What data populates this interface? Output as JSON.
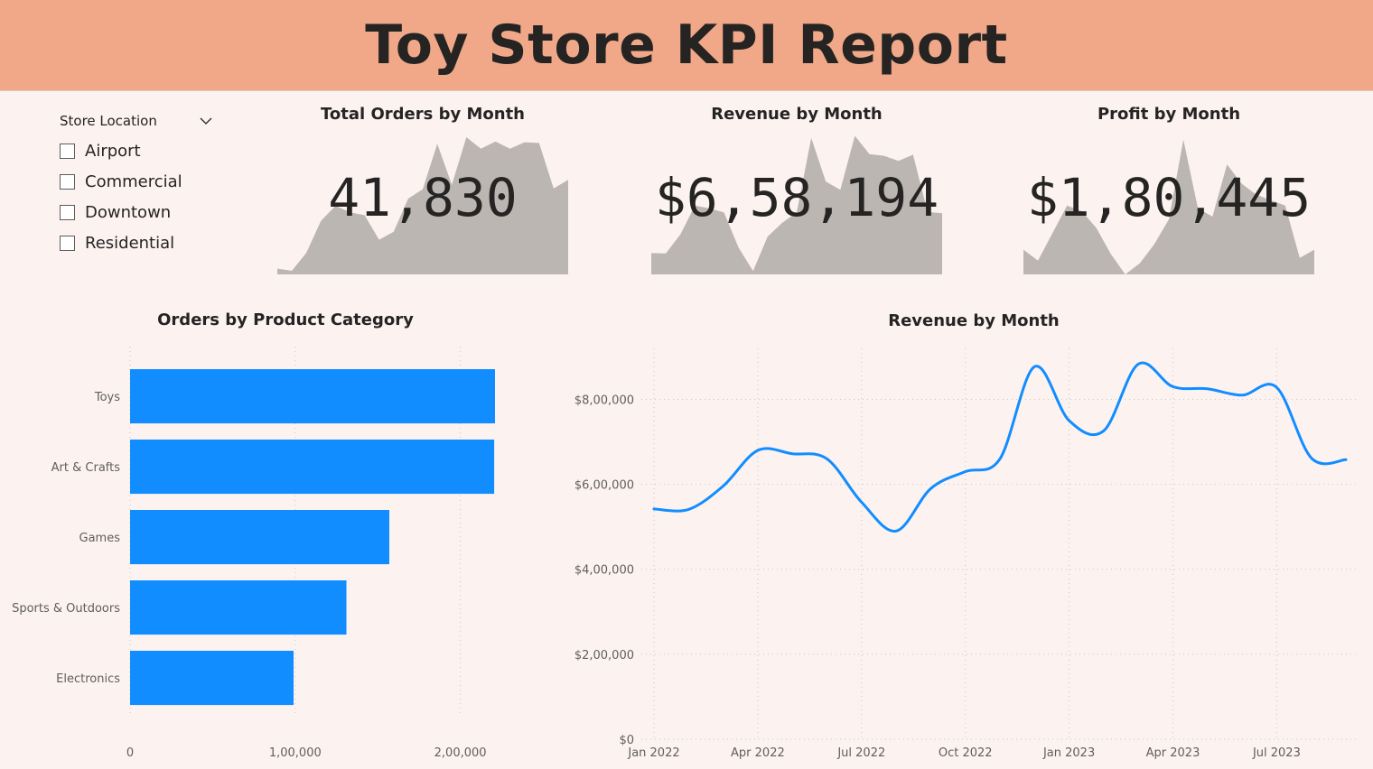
{
  "report": {
    "title": "Toy Store KPI Report"
  },
  "slicer": {
    "title": "Store Location",
    "options": [
      "Airport",
      "Commercial",
      "Downtown",
      "Residential"
    ]
  },
  "colors": {
    "header": "#f0a888",
    "background": "#fcf3f1",
    "bar": "#118dff",
    "line": "#118dff",
    "sparkline": "#bcb6b2"
  },
  "kpis": [
    {
      "title": "Total Orders by Month",
      "value": "41,830"
    },
    {
      "title": "Revenue by Month",
      "value": "$6,58,194"
    },
    {
      "title": "Profit by Month",
      "value": "$1,80,445"
    }
  ],
  "chart_data": [
    {
      "type": "area",
      "id": "orders-sparkline",
      "x": [
        "Jan 2022",
        "Feb 2022",
        "Mar 2022",
        "Apr 2022",
        "May 2022",
        "Jun 2022",
        "Jul 2022",
        "Aug 2022",
        "Sep 2022",
        "Oct 2022",
        "Nov 2022",
        "Dec 2022",
        "Jan 2023",
        "Feb 2023",
        "Mar 2023",
        "Apr 2023",
        "May 2023",
        "Jun 2023",
        "Jul 2023",
        "Aug 2023",
        "Sep 2023"
      ],
      "values": [
        1480,
        1450,
        1700,
        2140,
        2350,
        2260,
        2220,
        1880,
        1990,
        2450,
        2580,
        3210,
        2640,
        3300,
        3140,
        3240,
        3140,
        3230,
        3220,
        2590,
        2710
      ],
      "ylim": [
        1400,
        3400
      ]
    },
    {
      "type": "area",
      "id": "revenue-sparkline",
      "x": [
        "Jan 2022",
        "Feb 2022",
        "Mar 2022",
        "Apr 2022",
        "May 2022",
        "Jun 2022",
        "Jul 2022",
        "Aug 2022",
        "Sep 2022",
        "Oct 2022",
        "Nov 2022",
        "Dec 2022",
        "Jan 2023",
        "Feb 2023",
        "Mar 2023",
        "Apr 2023",
        "May 2023",
        "Jun 2023",
        "Jul 2023",
        "Aug 2023",
        "Sep 2023"
      ],
      "values": [
        542000,
        541000,
        596000,
        680000,
        672000,
        660000,
        558000,
        490000,
        590000,
        630000,
        660000,
        877000,
        750000,
        726000,
        883000,
        830000,
        825000,
        810000,
        828000,
        662000,
        658000
      ],
      "ylim": [
        480000,
        900000
      ]
    },
    {
      "type": "area",
      "id": "profit-sparkline",
      "x": [
        "Jan 2022",
        "Feb 2022",
        "Mar 2022",
        "Apr 2022",
        "May 2022",
        "Jun 2022",
        "Jul 2022",
        "Aug 2022",
        "Sep 2022",
        "Oct 2022",
        "Nov 2022",
        "Dec 2022",
        "Jan 2023",
        "Feb 2023",
        "Mar 2023",
        "Apr 2023",
        "May 2023",
        "Jun 2023",
        "Jul 2023",
        "Aug 2023",
        "Sep 2023"
      ],
      "values": [
        148000,
        140000,
        160000,
        180000,
        176000,
        164000,
        145000,
        130000,
        138000,
        152000,
        170000,
        228000,
        178000,
        172000,
        210000,
        196000,
        188000,
        184000,
        180000,
        142000,
        148000
      ],
      "ylim": [
        130000,
        235000
      ]
    },
    {
      "type": "bar",
      "id": "orders-by-category",
      "title": "Orders by Product Category",
      "orientation": "horizontal",
      "categories": [
        "Toys",
        "Art & Crafts",
        "Games",
        "Sports & Outdoors",
        "Electronics"
      ],
      "values": [
        221000,
        220500,
        157000,
        131000,
        99000
      ],
      "xlim": [
        0,
        250000
      ],
      "xticks": [
        0,
        100000,
        200000
      ],
      "xtick_labels": [
        "0",
        "1,00,000",
        "2,00,000"
      ],
      "grid": true
    },
    {
      "type": "line",
      "id": "revenue-by-month",
      "title": "Revenue by Month",
      "x": [
        "Jan 2022",
        "Feb 2022",
        "Mar 2022",
        "Apr 2022",
        "May 2022",
        "Jun 2022",
        "Jul 2022",
        "Aug 2022",
        "Sep 2022",
        "Oct 2022",
        "Nov 2022",
        "Dec 2022",
        "Jan 2023",
        "Feb 2023",
        "Mar 2023",
        "Apr 2023",
        "May 2023",
        "Jun 2023",
        "Jul 2023",
        "Aug 2023",
        "Sep 2023"
      ],
      "values": [
        542000,
        541000,
        596000,
        680000,
        672000,
        660000,
        558000,
        490000,
        590000,
        630000,
        660000,
        877000,
        750000,
        726000,
        883000,
        830000,
        825000,
        810000,
        828000,
        662000,
        658000
      ],
      "ylim": [
        0,
        920000
      ],
      "yticks": [
        0,
        200000,
        400000,
        600000,
        800000
      ],
      "ytick_labels": [
        "$0",
        "$2,00,000",
        "$4,00,000",
        "$6,00,000",
        "$8,00,000"
      ],
      "xtick_labels": [
        "Jan 2022",
        "Apr 2022",
        "Jul 2022",
        "Oct 2022",
        "Jan 2023",
        "Apr 2023",
        "Jul 2023"
      ],
      "grid": true
    }
  ]
}
